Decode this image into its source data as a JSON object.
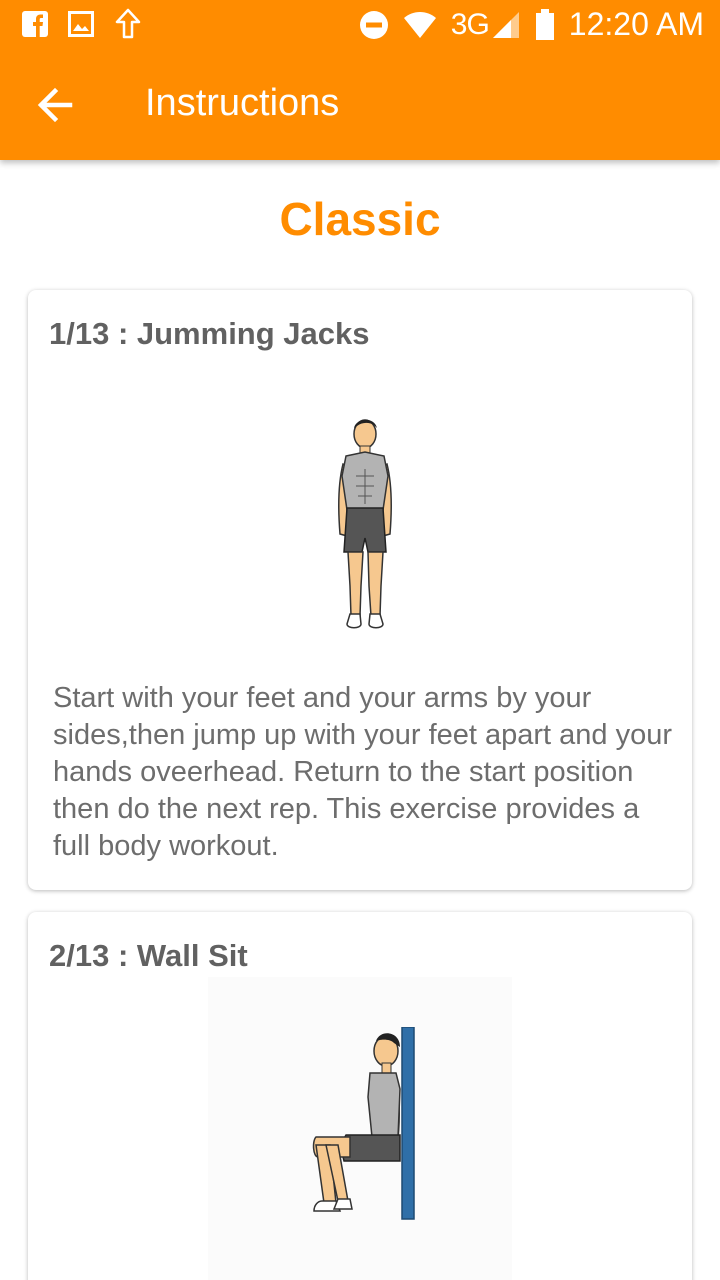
{
  "status_bar": {
    "network": "3G",
    "time": "12:20 AM"
  },
  "toolbar": {
    "back_icon": "arrow-left-icon",
    "title": "Instructions"
  },
  "section": {
    "title": "Classic"
  },
  "exercises": [
    {
      "title": "1/13 : Jumming Jacks",
      "image": "jumping-jacks-figure",
      "description": "Start with your feet and your arms by your sides,then jump up with your feet apart and your hands oveerhead. Return to the start position then do the next rep. This exercise provides a full body workout."
    },
    {
      "title": "2/13 : Wall Sit",
      "image": "wall-sit-figure"
    }
  ],
  "colors": {
    "primary": "#FF8C00",
    "title_text": "#616161",
    "body_text": "#6d6d6d"
  }
}
